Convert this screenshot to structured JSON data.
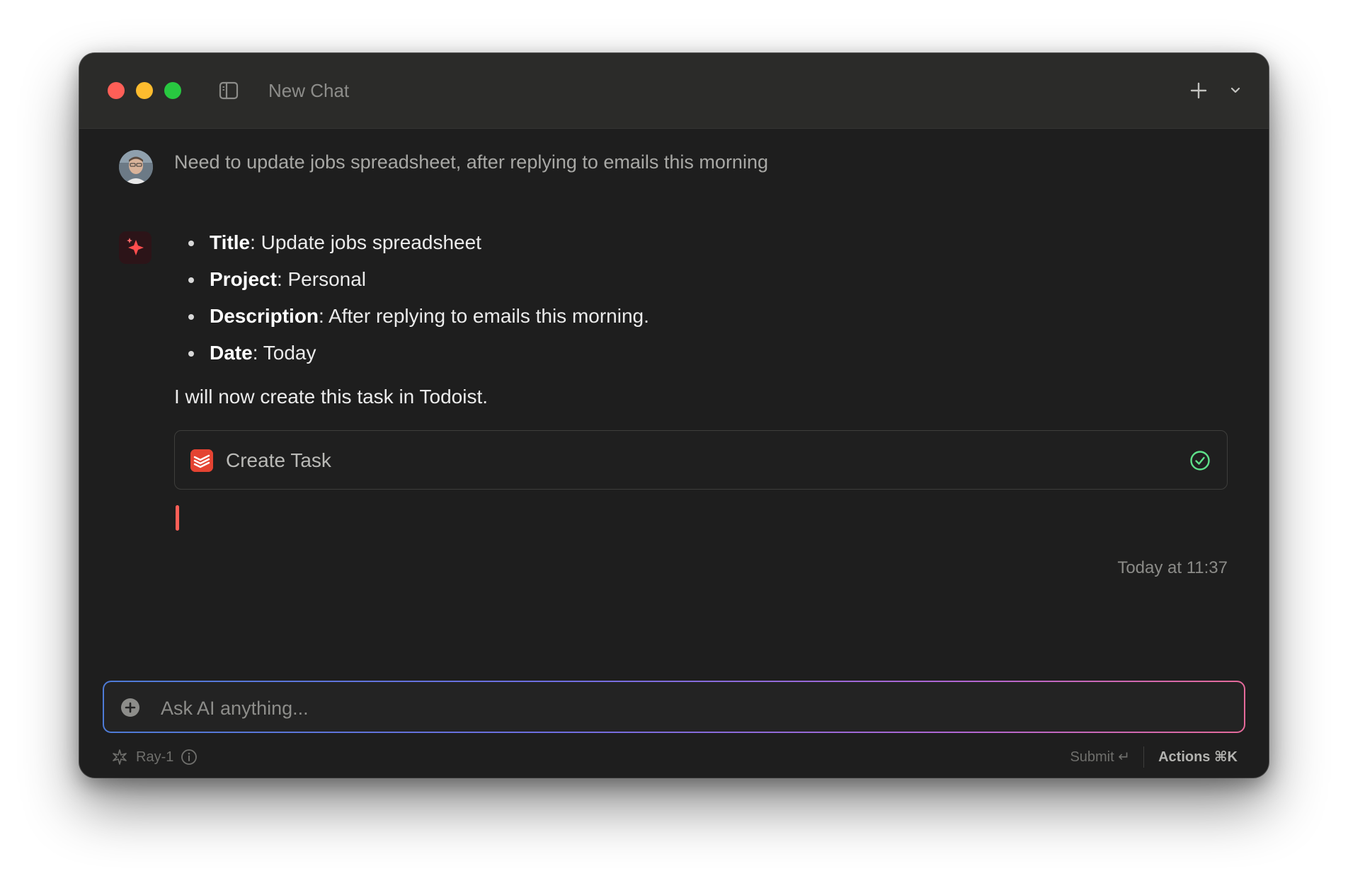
{
  "window": {
    "title": "New Chat"
  },
  "chat": {
    "user_message": "Need to update jobs spreadsheet, after replying to emails this morning",
    "ai_fields": [
      {
        "key": "Title",
        "value": "Update jobs spreadsheet"
      },
      {
        "key": "Project",
        "value": "Personal"
      },
      {
        "key": "Description",
        "value": "After replying to emails this morning."
      },
      {
        "key": "Date",
        "value": "Today"
      }
    ],
    "ai_statement": "I will now create this task in Todoist.",
    "tool_call": {
      "label": "Create Task",
      "status": "completed"
    },
    "timestamp": "Today at 11:37"
  },
  "composer": {
    "placeholder": "Ask AI anything...",
    "value": ""
  },
  "footer": {
    "model": "Ray-1",
    "submit_label": "Submit ↵",
    "actions_label": "Actions ⌘K"
  },
  "colors": {
    "accent_red": "#ff5f57",
    "success_green": "#5ee08a",
    "todoist_red": "#e44332"
  },
  "icons": {
    "sidebar_toggle": "sidebar-toggle-icon",
    "new_chat": "plus-icon",
    "menu": "chevron-down-icon",
    "ai": "sparkle-icon",
    "tool": "todoist-icon",
    "status": "check-circle-icon",
    "attach": "plus-circle-icon",
    "model": "ray-icon",
    "info": "info-icon"
  }
}
